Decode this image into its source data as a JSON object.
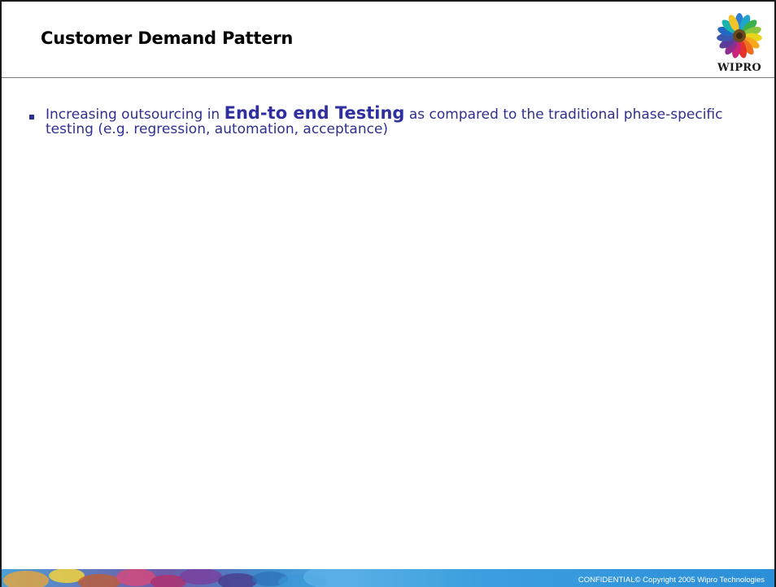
{
  "slide": {
    "title": "Customer Demand Pattern",
    "logo_text": "WIPRO",
    "bullets": [
      {
        "prefix": "Increasing outsourcing in ",
        "emphasis": "End-to end Testing",
        "suffix": " as compared to the traditional phase-specific testing (e.g. regression, automation, acceptance)"
      }
    ],
    "footer_text": "CONFIDENTIAL© Copyright 2005 Wipro Technologies"
  },
  "colors": {
    "title": "#000000",
    "bullet_text": "#2f2f8f",
    "footer_bar": "#3d9fdf",
    "footer_text": "#ffffff"
  },
  "icons": {
    "logo": "wipro-sunflower-logo"
  }
}
